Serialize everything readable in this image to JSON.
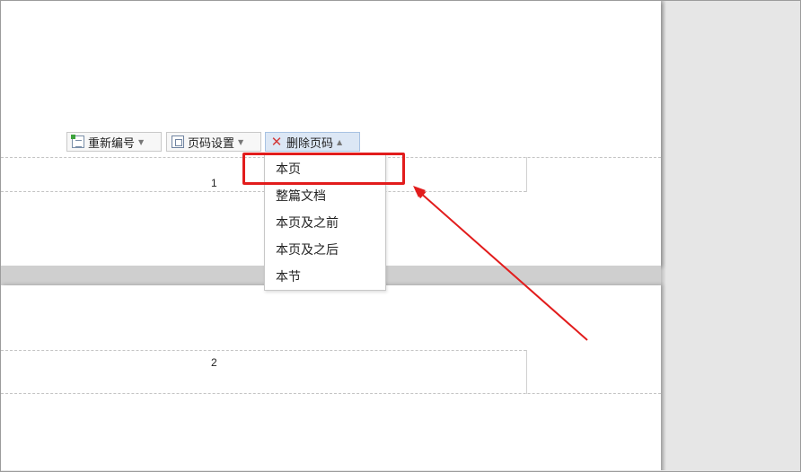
{
  "toolbar": {
    "renumber_label": "重新编号",
    "page_setting_label": "页码设置",
    "delete_label": "删除页码"
  },
  "delete_menu": {
    "items": [
      "本页",
      "整篇文档",
      "本页及之前",
      "本页及之后",
      "本节"
    ],
    "highlighted_index": 0
  },
  "pages": {
    "page1_number": "1",
    "page2_number": "2"
  },
  "colors": {
    "highlight_box": "#e21c1c",
    "arrow": "#e21c1c",
    "active_button": "#dce7f5"
  },
  "icons": {
    "renumber": "renumber-icon",
    "page_setting": "page-setting-icon",
    "delete": "red-x-icon"
  }
}
